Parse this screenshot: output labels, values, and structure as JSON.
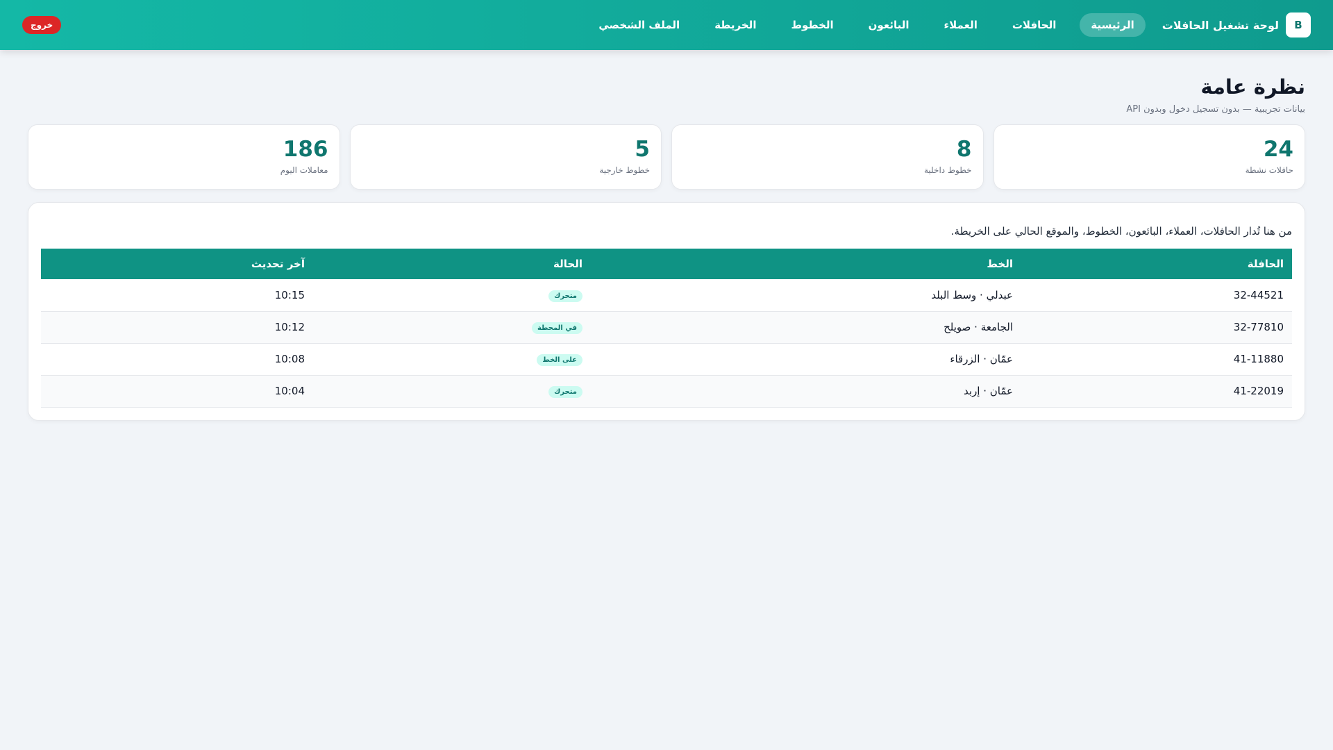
{
  "header": {
    "brand_logo": "B",
    "brand_title": "لوحة تشغيل الحافلات",
    "nav": [
      {
        "label": "الرئيسية",
        "active": true
      },
      {
        "label": "الحافلات"
      },
      {
        "label": "العملاء"
      },
      {
        "label": "البائعون"
      },
      {
        "label": "الخطوط"
      },
      {
        "label": "الخريطة"
      },
      {
        "label": "الملف الشخصي"
      }
    ],
    "logout_label": "خروج",
    "colors": {
      "bar": "#14b8a6",
      "logout": "#dc2626"
    }
  },
  "page": {
    "title": "نظرة عامة",
    "subtitle": "بيانات تجريبية — بدون تسجيل دخول وبدون API"
  },
  "stats": [
    {
      "value": "24",
      "label": "حافلات نشطة"
    },
    {
      "value": "8",
      "label": "خطوط داخلية"
    },
    {
      "value": "5",
      "label": "خطوط خارجية"
    },
    {
      "value": "186",
      "label": "معاملات اليوم"
    }
  ],
  "panel": {
    "description": "من هنا تُدار الحافلات، العملاء، البائعون، الخطوط، والموقع الحالي على الخريطة.",
    "table": {
      "headers": [
        "الحافلة",
        "الخط",
        "الحالة",
        "آخر تحديث"
      ],
      "rows": [
        {
          "bus": "32-44521",
          "line": "عبدلي · وسط البلد",
          "status": "متحرك",
          "updated": "10:15"
        },
        {
          "bus": "32-77810",
          "line": "الجامعة · صويلح",
          "status": "في المحطة",
          "updated": "10:12"
        },
        {
          "bus": "41-11880",
          "line": "عمّان · الزرقاء",
          "status": "على الخط",
          "updated": "10:08"
        },
        {
          "bus": "41-22019",
          "line": "عمّان · إربد",
          "status": "متحرك",
          "updated": "10:04"
        }
      ]
    }
  }
}
